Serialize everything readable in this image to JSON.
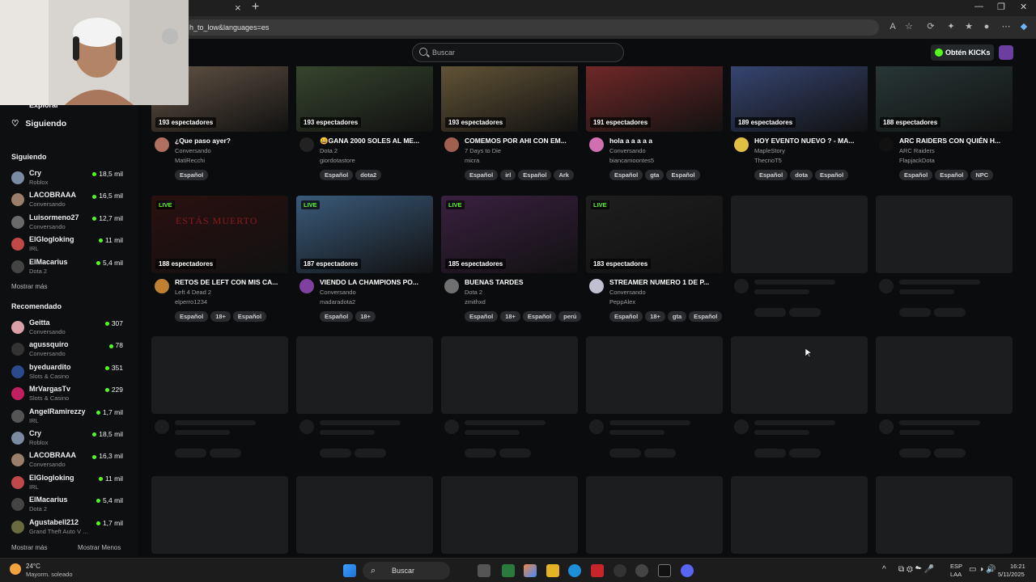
{
  "browser": {
    "url": "h_to_low&languages=es",
    "tab_close": "×",
    "tab_new": "+"
  },
  "header": {
    "search_placeholder": "Buscar",
    "kicks_label": "Obtén KICKs"
  },
  "sidebar": {
    "explorar_label": "Explorar",
    "siguiendo_nav": "Siguiendo",
    "following_title": "Siguiendo",
    "following": [
      {
        "name": "Cry",
        "category": "Roblox",
        "viewers": "18,5 mil",
        "color": "#7a8aa0"
      },
      {
        "name": "LACOBRAAA",
        "category": "Conversando",
        "viewers": "16,5 mil",
        "color": "#9a7e6a"
      },
      {
        "name": "Luisormeno27",
        "category": "Conversando",
        "viewers": "12,7 mil",
        "color": "#6a6a6a"
      },
      {
        "name": "ElGlogloking",
        "category": "IRL",
        "viewers": "11 mil",
        "color": "#c04848"
      },
      {
        "name": "ElMacarius",
        "category": "Dota 2",
        "viewers": "5,4 mil",
        "color": "#444"
      }
    ],
    "show_more_1": "Mostrar más",
    "recommended_title": "Recomendado",
    "recommended": [
      {
        "name": "Geitta",
        "category": "Conversando",
        "viewers": "307",
        "color": "#d9a0a8"
      },
      {
        "name": "agussquiro",
        "category": "Conversando",
        "viewers": "78",
        "color": "#333"
      },
      {
        "name": "byeduardito",
        "category": "Slots & Casino",
        "viewers": "351",
        "color": "#2a4a8a"
      },
      {
        "name": "MrVargasTv",
        "category": "Slots & Casino",
        "viewers": "229",
        "color": "#c02060"
      },
      {
        "name": "AngelRamirezzy",
        "category": "IRL",
        "viewers": "1,7 mil",
        "color": "#555"
      },
      {
        "name": "Cry",
        "category": "Roblox",
        "viewers": "18,5 mil",
        "color": "#7a8aa0"
      },
      {
        "name": "LACOBRAAA",
        "category": "Conversando",
        "viewers": "16,3 mil",
        "color": "#9a7e6a"
      },
      {
        "name": "ElGlogloking",
        "category": "IRL",
        "viewers": "11 mil",
        "color": "#c04848"
      },
      {
        "name": "ElMacarius",
        "category": "Dota 2",
        "viewers": "5,4 mil",
        "color": "#444"
      },
      {
        "name": "Agustabell212",
        "category": "Grand Theft Auto V ...",
        "viewers": "1,7 mil",
        "color": "#6a6a40"
      }
    ],
    "show_more_2": "Mostrar más",
    "show_less": "Mostrar Menos"
  },
  "streams_row1": [
    {
      "viewers": "193 espectadores",
      "title": "¿Que paso ayer?",
      "category": "Conversando",
      "channel": "MatiRecchi",
      "tags": [
        "Español"
      ],
      "thumb": "#6b5a4a",
      "avatar": "#b07060"
    },
    {
      "viewers": "193 espectadores",
      "title": "😀GANA 2000 SOLES AL ME...",
      "category": "Dota 2",
      "channel": "giordotastore",
      "tags": [
        "Español",
        "dota2"
      ],
      "thumb": "#3a4a30",
      "avatar": "#222"
    },
    {
      "viewers": "193 espectadores",
      "title": "COMEMOS POR AHI CON EM...",
      "category": "7 Days to Die",
      "channel": "micra",
      "tags": [
        "Español",
        "irl",
        "Español",
        "Ark"
      ],
      "thumb": "#6a5a3a",
      "avatar": "#a06050"
    },
    {
      "viewers": "191 espectadores",
      "title": "hola a a a a a",
      "category": "Conversando",
      "channel": "biancamoontes5",
      "tags": [
        "Español",
        "gta",
        "Español"
      ],
      "thumb": "#7a2a2a",
      "avatar": "#d070b0"
    },
    {
      "viewers": "189 espectadores",
      "title": "HOY EVENTO NUEVO ? - MA...",
      "category": "MapleStory",
      "channel": "ThecnoT5",
      "tags": [
        "Español",
        "dota",
        "Español"
      ],
      "thumb": "#3a4a7a",
      "avatar": "#e0c040"
    },
    {
      "viewers": "188 espectadores",
      "title": "ARC RAIDERS CON QUIÉN H...",
      "category": "ARC Raiders",
      "channel": "FlapjackDota",
      "tags": [
        "Español",
        "Español",
        "NPC"
      ],
      "thumb": "#2a3a3a",
      "avatar": "#111"
    }
  ],
  "streams_row2": [
    {
      "live": "LIVE",
      "viewers": "188 espectadores",
      "title": "RETOS DE LEFT CON MIS CA...",
      "category": "Left 4 Dead 2",
      "channel": "elperro1234",
      "tags": [
        "Español",
        "18+",
        "Español"
      ],
      "thumb": "#2a1010",
      "avatar": "#c08030",
      "overlay": "ESTÁS MUERTO"
    },
    {
      "live": "LIVE",
      "viewers": "187 espectadores",
      "title": "VIENDO LA CHAMPIONS PO...",
      "category": "Conversando",
      "channel": "madaradota2",
      "tags": [
        "Español",
        "18+"
      ],
      "thumb": "#3a5a7a",
      "avatar": "#8040a0",
      "overlay": ""
    },
    {
      "live": "LIVE",
      "viewers": "185 espectadores",
      "title": "BUENAS TARDES",
      "category": "Dota 2",
      "channel": "zmithxd",
      "tags": [
        "Español",
        "18+",
        "Español",
        "perú"
      ],
      "thumb": "#3a2040",
      "avatar": "#707070",
      "overlay": ""
    },
    {
      "live": "LIVE",
      "viewers": "183 espectadores",
      "title": "STREAMER NUMERO 1 DE P...",
      "category": "Conversando",
      "channel": "PeppAlex",
      "tags": [
        "Español",
        "18+",
        "gta",
        "Español"
      ],
      "thumb": "#1e1e1e",
      "avatar": "#c0c0d0",
      "overlay": ""
    }
  ],
  "taskbar": {
    "weather_temp": "24°C",
    "weather_desc": "Mayorm. soleado",
    "search_label": "Buscar",
    "lang": "ESP",
    "lang2": "LAA",
    "time": "16:21",
    "date": "5/11/2025"
  }
}
